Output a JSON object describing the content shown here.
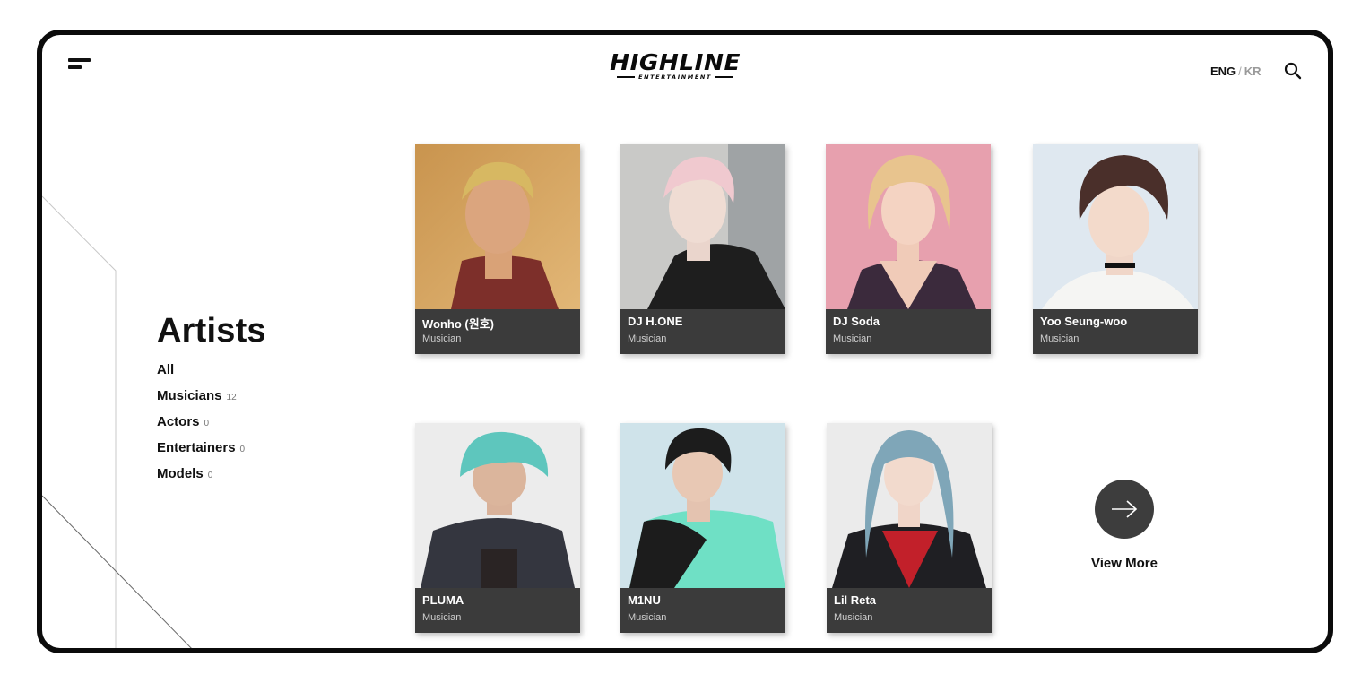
{
  "header": {
    "logo_main": "HIGHLINE",
    "logo_sub": "ENTERTAINMENT",
    "lang_active": "ENG",
    "lang_separator": "/",
    "lang_inactive": "KR",
    "menu_icon": "hamburger-menu-icon",
    "search_icon": "search-icon"
  },
  "sidebar": {
    "title": "Artists",
    "filters": [
      {
        "label": "All",
        "count": ""
      },
      {
        "label": "Musicians",
        "count": "12"
      },
      {
        "label": "Actors",
        "count": "0"
      },
      {
        "label": "Entertainers",
        "count": "0"
      },
      {
        "label": "Models",
        "count": "0"
      }
    ]
  },
  "artists": [
    {
      "name": "Wonho (원호)",
      "role": "Musician"
    },
    {
      "name": "DJ H.ONE",
      "role": "Musician"
    },
    {
      "name": "DJ Soda",
      "role": "Musician"
    },
    {
      "name": "Yoo Seung-woo",
      "role": "Musician"
    },
    {
      "name": "PLUMA",
      "role": "Musician"
    },
    {
      "name": "M1NU",
      "role": "Musician"
    },
    {
      "name": "Lil Reta",
      "role": "Musician"
    }
  ],
  "view_more": {
    "label": "View More",
    "icon": "arrow-right-icon"
  },
  "colors": {
    "frame": "#0b0b0b",
    "card_caption_bg": "#3b3b3b",
    "view_more_circle": "#3d3d3d",
    "inactive_lang": "#9a9a9a"
  }
}
